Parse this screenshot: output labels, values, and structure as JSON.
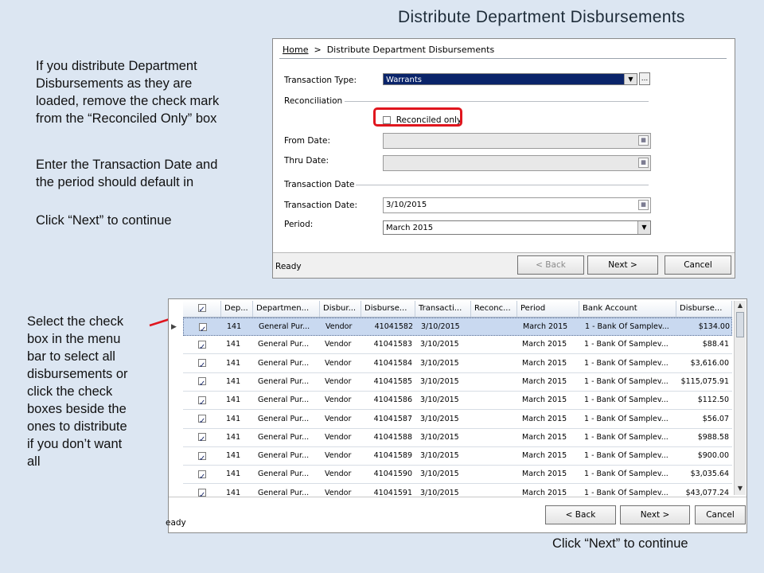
{
  "slide": {
    "title": "Distribute Department Disbursements",
    "note1": [
      "If you distribute Department",
      "Disbursements as they are",
      "loaded, remove the check mark",
      "from the “Reconciled Only” box"
    ],
    "note2": [
      "Enter the Transaction Date and",
      "the period should default in"
    ],
    "note3": "Click “Next” to continue",
    "note4": [
      "Select the check",
      "box in the menu",
      "bar to select all",
      "disbursements or",
      "click the check",
      "boxes beside the",
      "ones to distribute",
      "if you don’t want",
      "all"
    ],
    "note5": "Click “Next” to continue",
    "highlight_color": "#e0161e"
  },
  "dialog1": {
    "breadcrumb_home": "Home",
    "breadcrumb_sep": ">",
    "breadcrumb_current": "Distribute Department Disbursements",
    "transaction_type_label": "Transaction Type:",
    "transaction_type_value": "Warrants",
    "ellipsis": "...",
    "reconciliation_section": "Reconciliation",
    "reconciled_only_label": "Reconciled only",
    "from_date_label": "From Date:",
    "thru_date_label": "Thru Date:",
    "transaction_date_section": "Transaction Date",
    "transaction_date_label": "Transaction Date:",
    "transaction_date_value": "3/10/2015",
    "period_label": "Period:",
    "period_value": "March 2015",
    "status": "Ready",
    "back": "< Back",
    "next": "Next >",
    "cancel": "Cancel"
  },
  "dialog2": {
    "columns": [
      "Dep...",
      "Departmen...",
      "Disbur...",
      "Disburse...",
      "Transacti...",
      "Reconc...",
      "Period",
      "Bank Account",
      "Disburse..."
    ],
    "rows": [
      [
        "141",
        "General Pur...",
        "Vendor",
        "41041582",
        "3/10/2015",
        "",
        "March 2015",
        "1 - Bank Of Samplev...",
        "$134.00"
      ],
      [
        "141",
        "General Pur...",
        "Vendor",
        "41041583",
        "3/10/2015",
        "",
        "March 2015",
        "1 - Bank Of Samplev...",
        "$88.41"
      ],
      [
        "141",
        "General Pur...",
        "Vendor",
        "41041584",
        "3/10/2015",
        "",
        "March 2015",
        "1 - Bank Of Samplev...",
        "$3,616.00"
      ],
      [
        "141",
        "General Pur...",
        "Vendor",
        "41041585",
        "3/10/2015",
        "",
        "March 2015",
        "1 - Bank Of Samplev...",
        "$115,075.91"
      ],
      [
        "141",
        "General Pur...",
        "Vendor",
        "41041586",
        "3/10/2015",
        "",
        "March 2015",
        "1 - Bank Of Samplev...",
        "$112.50"
      ],
      [
        "141",
        "General Pur...",
        "Vendor",
        "41041587",
        "3/10/2015",
        "",
        "March 2015",
        "1 - Bank Of Samplev...",
        "$56.07"
      ],
      [
        "141",
        "General Pur...",
        "Vendor",
        "41041588",
        "3/10/2015",
        "",
        "March 2015",
        "1 - Bank Of Samplev...",
        "$988.58"
      ],
      [
        "141",
        "General Pur...",
        "Vendor",
        "41041589",
        "3/10/2015",
        "",
        "March 2015",
        "1 - Bank Of Samplev...",
        "$900.00"
      ],
      [
        "141",
        "General Pur...",
        "Vendor",
        "41041590",
        "3/10/2015",
        "",
        "March 2015",
        "1 - Bank Of Samplev...",
        "$3,035.64"
      ],
      [
        "141",
        "General Pur...",
        "Vendor",
        "41041591",
        "3/10/2015",
        "",
        "March 2015",
        "1 - Bank Of Samplev...",
        "$43,077.24"
      ]
    ],
    "status": "eady",
    "back": "< Back",
    "next": "Next >",
    "cancel": "Cancel"
  }
}
